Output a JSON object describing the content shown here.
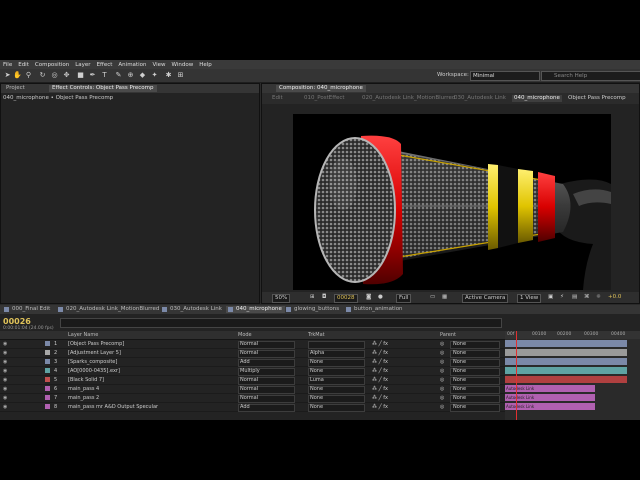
{
  "menu": [
    "File",
    "Edit",
    "Composition",
    "Layer",
    "Effect",
    "Animation",
    "View",
    "Window",
    "Help"
  ],
  "workspace": {
    "label": "Workspace:",
    "value": "Minimal"
  },
  "search": {
    "placeholder": "Search Help"
  },
  "left_panel": {
    "tabs": [
      "Project",
      "Effect Controls: Object Pass Precomp"
    ],
    "subtitle": "040_microphone • Object Pass Precomp"
  },
  "comp_panel": {
    "tab": "Composition: 040_microphone",
    "breadcrumbs": [
      "Edit",
      "010_PostEffect",
      "020_Autodesk Link_MotionBlurred",
      "030_Autodesk Link",
      "040_microphone",
      "Object Pass Precomp"
    ],
    "controls": {
      "zoom": "50%",
      "timecode": "00028",
      "resolution": "Full",
      "camera": "Active Camera",
      "views": "1 View",
      "offset": "+0.0"
    }
  },
  "timeline_tabs": [
    "000_Final Edit",
    "020_Autodesk Link_MotionBlurred",
    "030_Autodesk Link",
    "040_microphone",
    "glowing_buttons",
    "button_animation"
  ],
  "timeline": {
    "timecode": "00026",
    "timecode_sub": "0:00:01:04 (24.00 fps)",
    "headers": {
      "layer": "Layer Name",
      "mode": "Mode",
      "trkmat": "TrkMat",
      "parent": "Parent"
    },
    "ruler": [
      "00f",
      "00100",
      "00200",
      "00300",
      "00400"
    ],
    "layers": [
      {
        "num": "1",
        "name": "[Object Pass Precomp]",
        "mode": "Normal",
        "trkmat": "",
        "parent": "None",
        "color": "#7b89a8"
      },
      {
        "num": "2",
        "name": "[Adjustment Layer 5]",
        "mode": "Normal",
        "trkmat": "Alpha",
        "parent": "None",
        "color": "#a8a8a8"
      },
      {
        "num": "3",
        "name": "[Sparks_composite]",
        "mode": "Add",
        "trkmat": "None",
        "parent": "None",
        "color": "#7b89a8"
      },
      {
        "num": "4",
        "name": "[AO[0000-0435].exr]",
        "mode": "Multiply",
        "trkmat": "None",
        "parent": "None",
        "color": "#5fa3a3"
      },
      {
        "num": "5",
        "name": "[Black Solid 7]",
        "mode": "Normal",
        "trkmat": "Luma",
        "parent": "None",
        "color": "#c05050"
      },
      {
        "num": "6",
        "name": "main_pass 4",
        "mode": "Normal",
        "trkmat": "None",
        "parent": "None",
        "color": "#b060b0"
      },
      {
        "num": "7",
        "name": "main_pass 2",
        "mode": "Normal",
        "trkmat": "None",
        "parent": "None",
        "color": "#b060b0"
      },
      {
        "num": "8",
        "name": "main_pass mr A&D Output Specular",
        "mode": "Add",
        "trkmat": "None",
        "parent": "None",
        "color": "#b060b0"
      }
    ],
    "track_labels": [
      "Autodesk Link",
      "Autodesk Link",
      "Autodesk Link"
    ]
  }
}
